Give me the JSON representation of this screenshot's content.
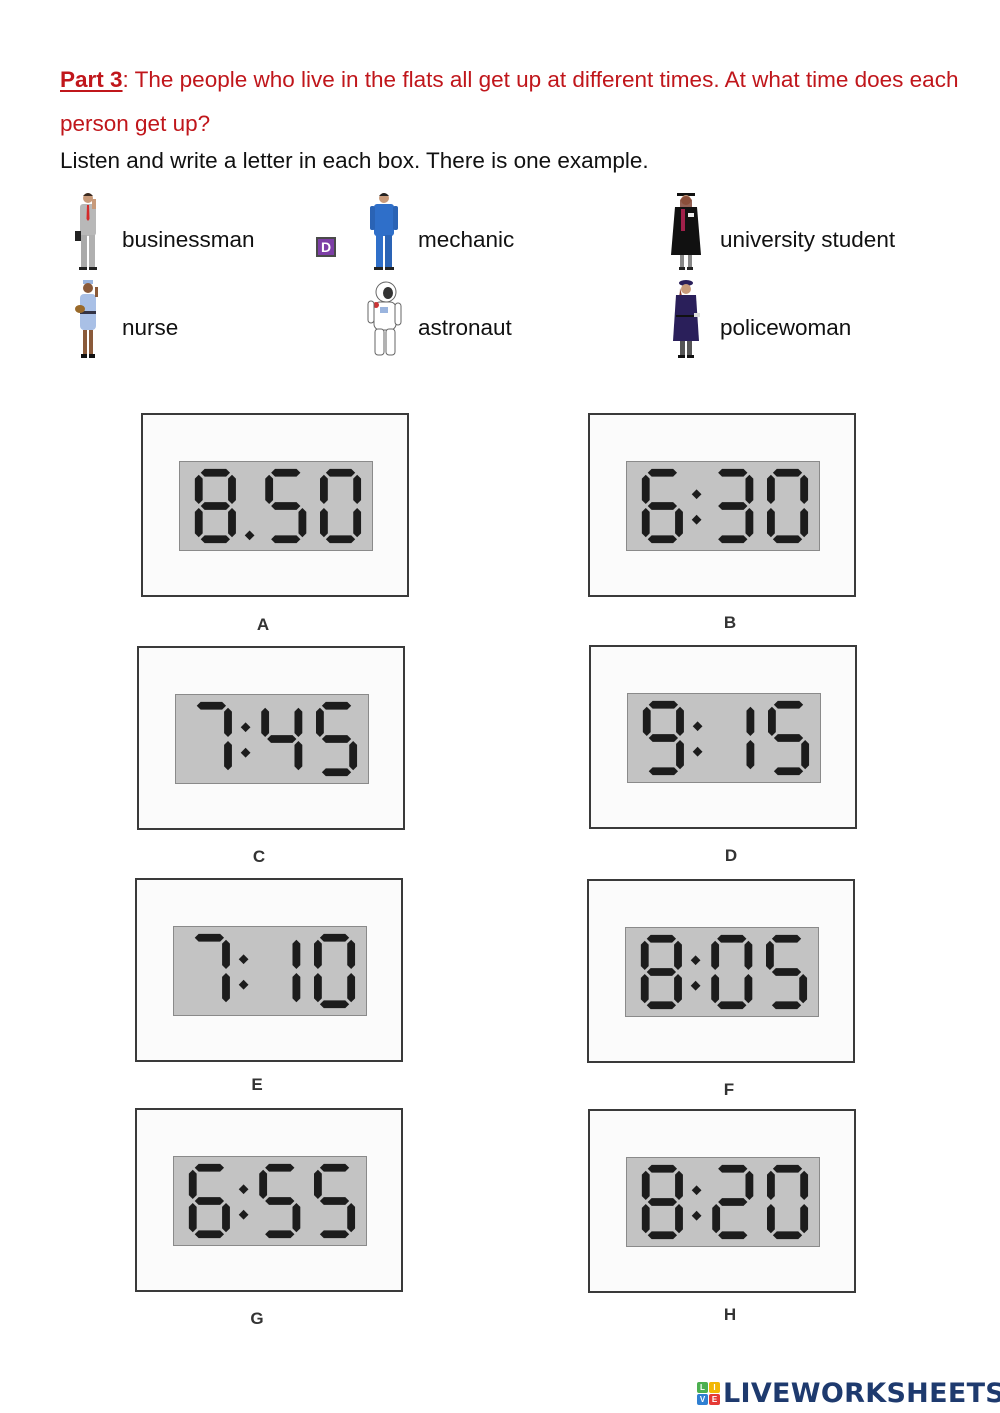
{
  "instructions": {
    "part_label": "Part 3",
    "question": ": The people who live in the flats all get up at different times. At what time does each person get up?",
    "task": "Listen and write a letter in each box. There is one example."
  },
  "people": [
    {
      "name": "businessman",
      "icon": "businessman-figure-icon",
      "answer": "D",
      "is_example": true
    },
    {
      "name": "mechanic",
      "icon": "mechanic-figure-icon",
      "answer": ""
    },
    {
      "name": "university student",
      "icon": "graduate-figure-icon",
      "answer": ""
    },
    {
      "name": "nurse",
      "icon": "nurse-figure-icon",
      "answer": ""
    },
    {
      "name": "astronaut",
      "icon": "astronaut-figure-icon",
      "answer": ""
    },
    {
      "name": "policewoman",
      "icon": "policewoman-figure-icon",
      "answer": ""
    }
  ],
  "clocks": [
    {
      "letter": "A",
      "time": "8.50",
      "digits": "850",
      "separator": "dot"
    },
    {
      "letter": "B",
      "time": "6:30",
      "digits": "630",
      "separator": "colon"
    },
    {
      "letter": "C",
      "time": "7:45",
      "digits": "745",
      "separator": "colon"
    },
    {
      "letter": "D",
      "time": "9:15",
      "digits": "915",
      "separator": "colon"
    },
    {
      "letter": "E",
      "time": "7:10",
      "digits": "710",
      "separator": "colon"
    },
    {
      "letter": "F",
      "time": "8:05",
      "digits": "805",
      "separator": "colon"
    },
    {
      "letter": "G",
      "time": "6:55",
      "digits": "655",
      "separator": "colon"
    },
    {
      "letter": "H",
      "time": "8:20",
      "digits": "820",
      "separator": "colon"
    }
  ],
  "branding": {
    "logo_tiles": [
      "L",
      "I",
      "V",
      "E"
    ],
    "logo_tile_colors": [
      "#4caf50",
      "#f2b705",
      "#2f7fd1",
      "#e53935"
    ],
    "wordmark": "LIVEWORKSHEETS"
  },
  "colors": {
    "instruction_red": "#c0161b",
    "answer_box_fill": "#7d3ea6",
    "lcd_background": "#c3c3c3",
    "lcd_segment": "#1c1c1c",
    "brand_navy": "#1e3a6e"
  }
}
